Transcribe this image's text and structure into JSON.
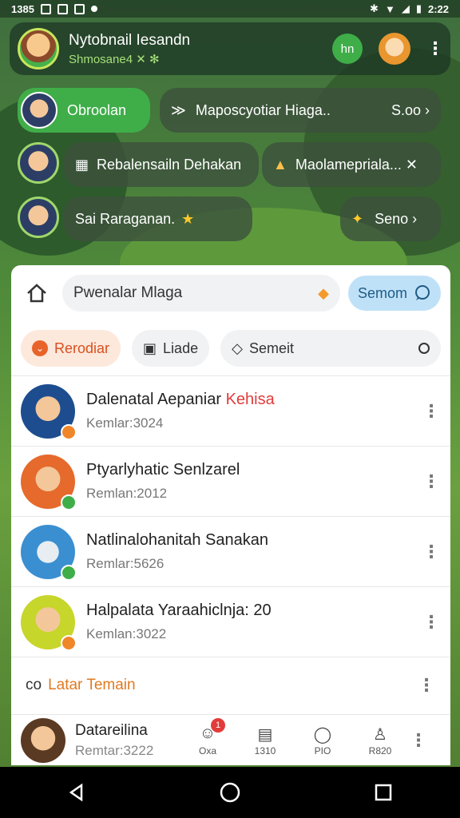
{
  "status_bar": {
    "time_left": "1385",
    "time_right": "2:22"
  },
  "header": {
    "title": "Nytobnail Iesandn",
    "subtitle": "Shmosane4 ✕ ✻",
    "badge_text": "hn"
  },
  "chips": {
    "obroolan": {
      "label": "Obroolan"
    },
    "group": {
      "label": "Maposcyotiar Hiaga..",
      "count": "S.oo ›"
    },
    "rebalensailn": {
      "label": "Rebalensailn Dehakan"
    },
    "maolame": {
      "label": "Maolamepriala... ✕"
    },
    "sai": {
      "label": "Sai Raraganan."
    },
    "seno": {
      "label": "Seno ›"
    }
  },
  "search": {
    "placeholder": "Pwenalar Mlaga",
    "button_label": "Semom"
  },
  "filters": [
    {
      "label": "Rerodiar"
    },
    {
      "label": "Liade"
    },
    {
      "label": "Semeit"
    }
  ],
  "chats": [
    {
      "title": "Dalenatal Aepaniar",
      "highlight": "Kehisa",
      "subtitle": "Kemlar:3024"
    },
    {
      "title": "Ptyarlyhatic Senlzarel",
      "highlight": "",
      "subtitle": "Remlan:2012"
    },
    {
      "title": "Natlinalohanitah Sanakan",
      "highlight": "",
      "subtitle": "Remlar:5626"
    },
    {
      "title": "Halpalata Yaraahiclnja: 20",
      "highlight": "",
      "subtitle": "Kemlan:3022"
    }
  ],
  "friends": {
    "label": "Latar Temain",
    "icon": "co"
  },
  "bottom": {
    "title": "Datareilina",
    "subtitle": "Remtar:3222",
    "nav": [
      {
        "label": "Oxa",
        "badge": "1"
      },
      {
        "label": "1310",
        "badge": ""
      },
      {
        "label": "PIO",
        "badge": ""
      },
      {
        "label": "R820",
        "badge": ""
      }
    ]
  },
  "colors": {
    "accent": "#3fae49",
    "highlight": "#e23b3b",
    "orange": "#e07a22"
  }
}
